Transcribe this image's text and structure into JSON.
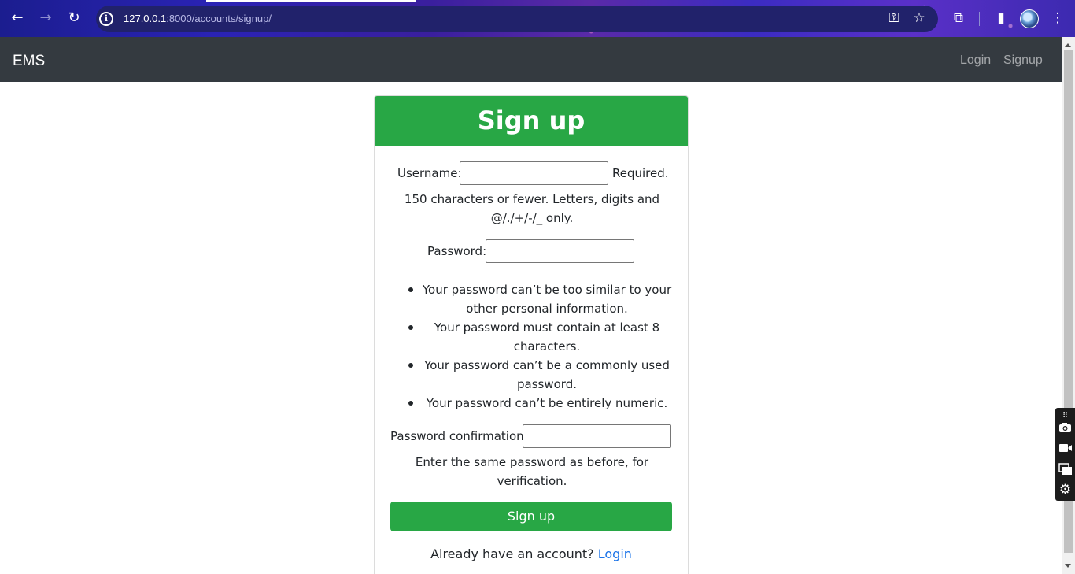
{
  "browser": {
    "url_host": "127.0.0.1",
    "url_rest": ":8000/accounts/signup/",
    "icons": {
      "back": "←",
      "forward": "→",
      "reload": "↻",
      "info": "i",
      "key": "⚿",
      "star": "☆",
      "extensions": "⧉",
      "sidebar": "▮",
      "menu": "⋮"
    }
  },
  "navbar": {
    "brand": "EMS",
    "login": "Login",
    "signup": "Signup"
  },
  "form": {
    "title": "Sign up",
    "username_label": "Username:",
    "username_required": "Required.",
    "username_help_line1": "150 characters or fewer. Letters, digits and",
    "username_help_line2": "@/./+/-/_ only.",
    "password_label": "Password:",
    "password_rules": [
      {
        "line1": "Your password can’t be too similar to your",
        "line2": "other personal information."
      },
      {
        "line1": "Your password must contain at least 8",
        "line2": "characters."
      },
      {
        "line1": "Your password can’t be a commonly used",
        "line2": "password."
      },
      {
        "line1": "Your password can’t be entirely numeric.",
        "line2": ""
      }
    ],
    "confirm_label": "Password confirmation:",
    "confirm_help_line1": "Enter the same password as before, for",
    "confirm_help_line2": "verification.",
    "submit": "Sign up",
    "have_account": "Already have an account?",
    "login_link": "Login"
  },
  "float_toolbar": {
    "icons": [
      "camera-icon",
      "video-icon",
      "window-icon",
      "gear-icon"
    ]
  },
  "colors": {
    "accent_green": "#28a745",
    "navbar_bg": "#343a40",
    "link_blue": "#1a73e8"
  }
}
